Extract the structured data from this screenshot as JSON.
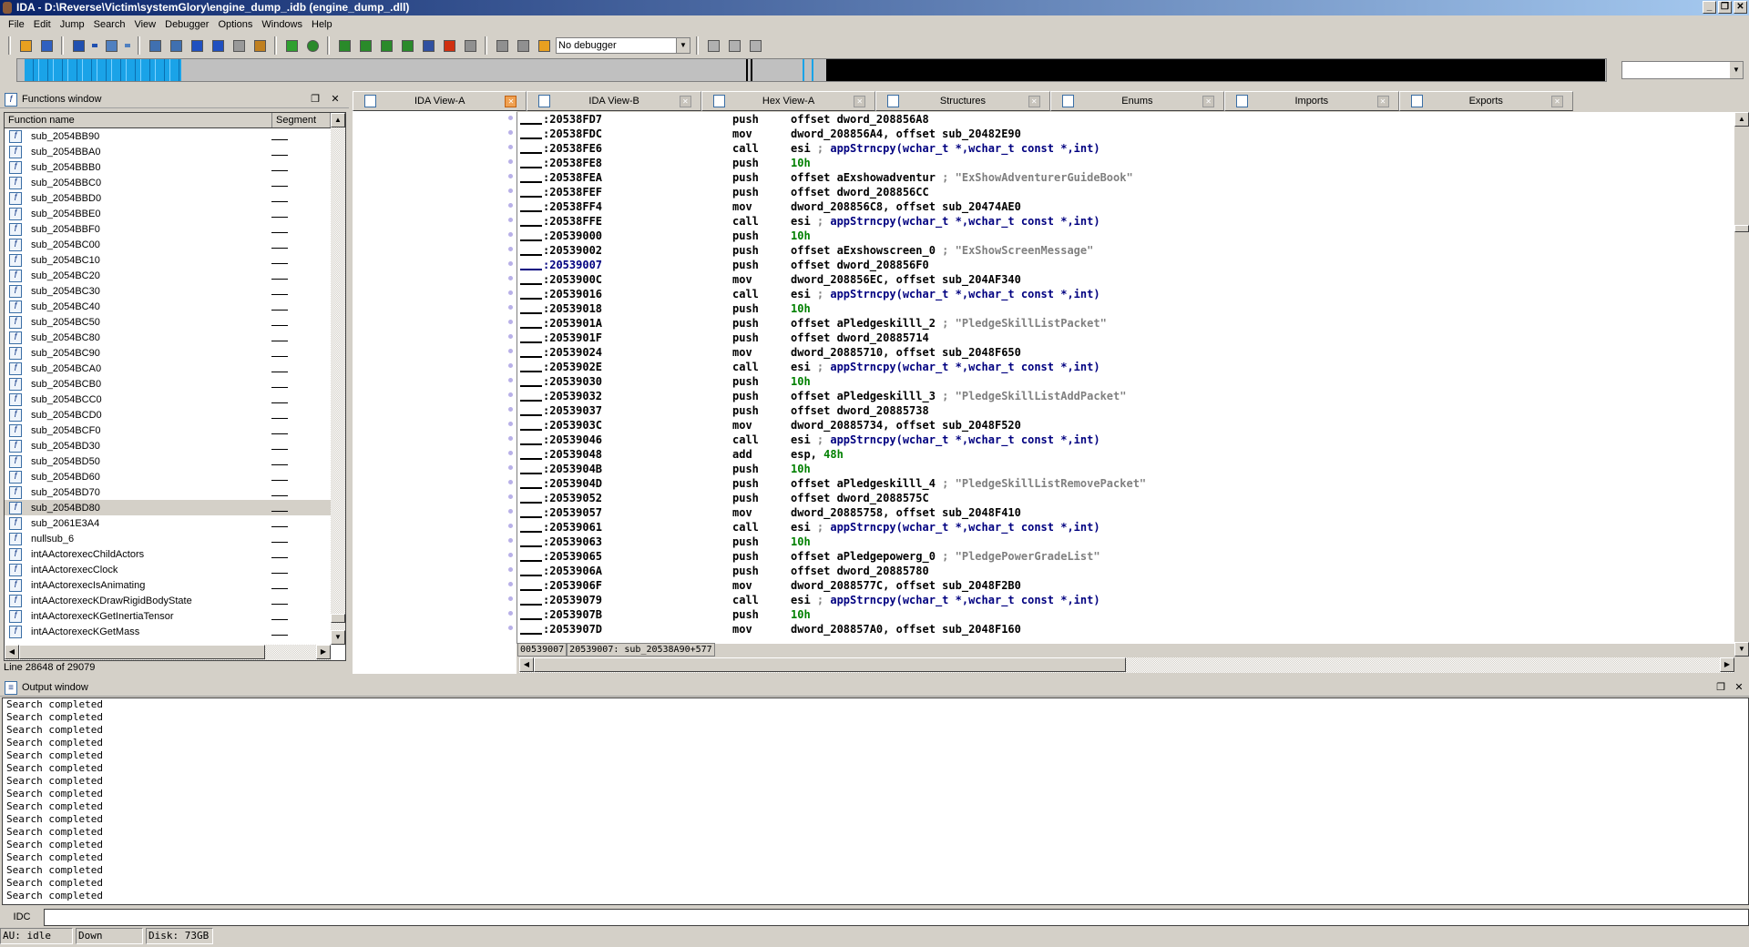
{
  "window": {
    "title": "IDA - D:\\Reverse\\Victim\\systemGlory\\engine_dump_.idb (engine_dump_.dll)",
    "controls": [
      "minimize",
      "restore",
      "close"
    ]
  },
  "menu": [
    "File",
    "Edit",
    "Jump",
    "Search",
    "View",
    "Debugger",
    "Options",
    "Windows",
    "Help"
  ],
  "toolbar": {
    "groups": [
      [
        "open-icon",
        "save-icon"
      ],
      [
        "back-arrow-icon",
        "back-dropdown-icon",
        "forward-arrow-icon",
        "forward-dropdown-icon"
      ],
      [
        "search-code-icon",
        "search-text-icon",
        "search-binary-icon",
        "search-next-icon",
        "jump-down-icon",
        "undo-icon"
      ],
      [
        "graph-icon",
        "green-circle-icon"
      ],
      [
        "make-code-icon",
        "make-data-icon",
        "make-array-icon",
        "make-string-icon",
        "make-offset-icon",
        "edit-icon",
        "delete-icon"
      ],
      [
        "run-icon",
        "pause-icon",
        "stop-icon"
      ]
    ],
    "debugger_select": "No debugger",
    "right_icons": [
      "breakpoints-icon",
      "add-breakpoint-icon",
      "remove-breakpoint-icon"
    ]
  },
  "functions": {
    "title": "Functions window",
    "columns": [
      "Function name",
      "Segment"
    ],
    "items": [
      "sub_2054BB90",
      "sub_2054BBA0",
      "sub_2054BBB0",
      "sub_2054BBC0",
      "sub_2054BBD0",
      "sub_2054BBE0",
      "sub_2054BBF0",
      "sub_2054BC00",
      "sub_2054BC10",
      "sub_2054BC20",
      "sub_2054BC30",
      "sub_2054BC40",
      "sub_2054BC50",
      "sub_2054BC80",
      "sub_2054BC90",
      "sub_2054BCA0",
      "sub_2054BCB0",
      "sub_2054BCC0",
      "sub_2054BCD0",
      "sub_2054BCF0",
      "sub_2054BD30",
      "sub_2054BD50",
      "sub_2054BD60",
      "sub_2054BD70",
      "sub_2054BD80",
      "sub_2061E3A4",
      "nullsub_6",
      "intAActorexecChildActors",
      "intAActorexecClock",
      "intAActorexecIsAnimating",
      "intAActorexecKDrawRigidBodyState",
      "intAActorexecKGetInertiaTensor",
      "intAActorexecKGetMass"
    ],
    "selected": "sub_2054BD80",
    "status": "Line 28648 of 29079"
  },
  "tabs": [
    {
      "label": "IDA View-A",
      "active": true
    },
    {
      "label": "IDA View-B"
    },
    {
      "label": "Hex View-A"
    },
    {
      "label": "Structures"
    },
    {
      "label": "Enums"
    },
    {
      "label": "Imports"
    },
    {
      "label": "Exports"
    }
  ],
  "colors": {
    "number": "#008000",
    "comment": "#000080",
    "string": "#808080",
    "nav_code": "#1aa3e8"
  },
  "disasm": {
    "cursor_addr": ":20539007",
    "lines": [
      {
        "addr": ":20538FD7",
        "mn": "push",
        "op": "offset dword_208856A8"
      },
      {
        "addr": ":20538FDC",
        "mn": "mov",
        "op": "dword_208856A4, offset sub_20482E90"
      },
      {
        "addr": ":20538FE6",
        "mn": "call",
        "op": "esi ",
        "sep": "; ",
        "cmt": "appStrncpy(wchar_t *,wchar_t const *,int)"
      },
      {
        "addr": ":20538FE8",
        "mn": "push",
        "num": "10h"
      },
      {
        "addr": ":20538FEA",
        "mn": "push",
        "op": "offset aExshowadventur ",
        "sep": "; ",
        "str": "\"ExShowAdventurerGuideBook\""
      },
      {
        "addr": ":20538FEF",
        "mn": "push",
        "op": "offset dword_208856CC"
      },
      {
        "addr": ":20538FF4",
        "mn": "mov",
        "op": "dword_208856C8, offset sub_20474AE0"
      },
      {
        "addr": ":20538FFE",
        "mn": "call",
        "op": "esi ",
        "sep": "; ",
        "cmt": "appStrncpy(wchar_t *,wchar_t const *,int)"
      },
      {
        "addr": ":20539000",
        "mn": "push",
        "num": "10h"
      },
      {
        "addr": ":20539002",
        "mn": "push",
        "op": "offset aExshowscreen_0 ",
        "sep": "; ",
        "str": "\"ExShowScreenMessage\""
      },
      {
        "addr": ":20539007",
        "mn": "push",
        "op": "offset dword_208856F0"
      },
      {
        "addr": ":2053900C",
        "mn": "mov",
        "op": "dword_208856EC, offset sub_204AF340"
      },
      {
        "addr": ":20539016",
        "mn": "call",
        "op": "esi ",
        "sep": "; ",
        "cmt": "appStrncpy(wchar_t *,wchar_t const *,int)"
      },
      {
        "addr": ":20539018",
        "mn": "push",
        "num": "10h"
      },
      {
        "addr": ":2053901A",
        "mn": "push",
        "op": "offset aPledgeskilll_2 ",
        "sep": "; ",
        "str": "\"PledgeSkillListPacket\""
      },
      {
        "addr": ":2053901F",
        "mn": "push",
        "op": "offset dword_20885714"
      },
      {
        "addr": ":20539024",
        "mn": "mov",
        "op": "dword_20885710, offset sub_2048F650"
      },
      {
        "addr": ":2053902E",
        "mn": "call",
        "op": "esi ",
        "sep": "; ",
        "cmt": "appStrncpy(wchar_t *,wchar_t const *,int)"
      },
      {
        "addr": ":20539030",
        "mn": "push",
        "num": "10h"
      },
      {
        "addr": ":20539032",
        "mn": "push",
        "op": "offset aPledgeskilll_3 ",
        "sep": "; ",
        "str": "\"PledgeSkillListAddPacket\""
      },
      {
        "addr": ":20539037",
        "mn": "push",
        "op": "offset dword_20885738"
      },
      {
        "addr": ":2053903C",
        "mn": "mov",
        "op": "dword_20885734, offset sub_2048F520"
      },
      {
        "addr": ":20539046",
        "mn": "call",
        "op": "esi ",
        "sep": "; ",
        "cmt": "appStrncpy(wchar_t *,wchar_t const *,int)"
      },
      {
        "addr": ":20539048",
        "mn": "add",
        "op": "esp, ",
        "num": "48h"
      },
      {
        "addr": ":2053904B",
        "mn": "push",
        "num": "10h"
      },
      {
        "addr": ":2053904D",
        "mn": "push",
        "op": "offset aPledgeskilll_4 ",
        "sep": "; ",
        "str": "\"PledgeSkillListRemovePacket\""
      },
      {
        "addr": ":20539052",
        "mn": "push",
        "op": "offset dword_2088575C"
      },
      {
        "addr": ":20539057",
        "mn": "mov",
        "op": "dword_20885758, offset sub_2048F410"
      },
      {
        "addr": ":20539061",
        "mn": "call",
        "op": "esi ",
        "sep": "; ",
        "cmt": "appStrncpy(wchar_t *,wchar_t const *,int)"
      },
      {
        "addr": ":20539063",
        "mn": "push",
        "num": "10h"
      },
      {
        "addr": ":20539065",
        "mn": "push",
        "op": "offset aPledgepowerg_0 ",
        "sep": "; ",
        "str": "\"PledgePowerGradeList\""
      },
      {
        "addr": ":2053906A",
        "mn": "push",
        "op": "offset dword_20885780"
      },
      {
        "addr": ":2053906F",
        "mn": "mov",
        "op": "dword_2088577C, offset sub_2048F2B0"
      },
      {
        "addr": ":20539079",
        "mn": "call",
        "op": "esi ",
        "sep": "; ",
        "cmt": "appStrncpy(wchar_t *,wchar_t const *,int)"
      },
      {
        "addr": ":2053907B",
        "mn": "push",
        "num": "10h"
      },
      {
        "addr": ":2053907D",
        "mn": "mov",
        "op": "dword_208857A0, offset sub_2048F160"
      }
    ],
    "status": [
      "00539007",
      "20539007: sub_20538A90+577"
    ]
  },
  "output": {
    "title": "Output window",
    "lines": [
      "Search completed",
      "Search completed",
      "Search completed",
      "Search completed",
      "Search completed",
      "Search completed",
      "Search completed",
      "Search completed",
      "Search completed",
      "Search completed",
      "Search completed",
      "Search completed",
      "Search completed",
      "Search completed",
      "Search completed",
      "Search completed"
    ]
  },
  "idc": {
    "label": "IDC",
    "value": ""
  },
  "statusbar": [
    "AU:  idle",
    "Down",
    "Disk: 73GB"
  ]
}
